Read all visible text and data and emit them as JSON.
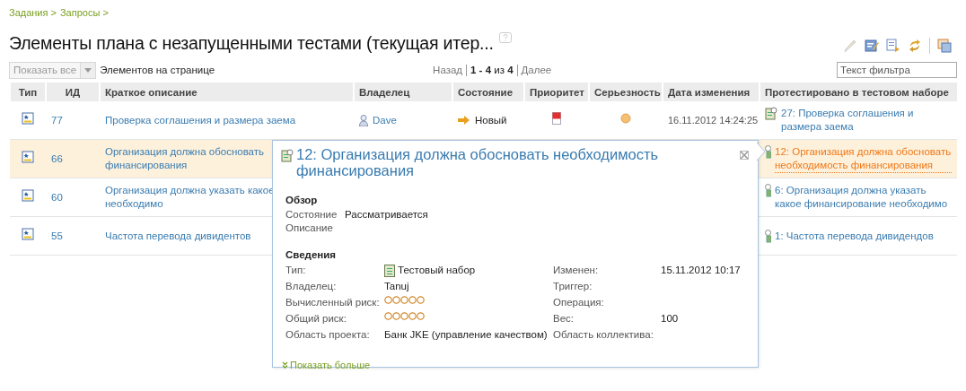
{
  "breadcrumb": [
    "Задания >",
    "Запросы >"
  ],
  "title": "Элементы плана с незапущенными тестами (текущая итер...",
  "toolbar": {
    "show_all": "Показать все",
    "per_page_label": "Элементов на странице",
    "prev": "Назад",
    "range": "**1 - 4** из **4**",
    "next": "Далее",
    "filter_placeholder": "Текст фильтра"
  },
  "table": {
    "columns": [
      "Тип",
      "ИД",
      "Краткое описание",
      "Владелец",
      "Состояние",
      "Приоритет",
      "Серьезность",
      "Дата изменения",
      "Протестировано в тестовом наборе"
    ],
    "rows": [
      {
        "id": "77",
        "summary": [
          "Проверка соглашения и размера заема"
        ],
        "owner": "Dave",
        "state": "Новый",
        "modified": "16.11.2012 14:24:25",
        "tested_in": "27: Проверка соглашения и размера заема",
        "covered": false,
        "selected": false
      },
      {
        "id": "66",
        "summary": [
          "Организация должна обосновать",
          "финансирования"
        ],
        "tested_in": "12: Организация должна обосновать необходимость финансирования",
        "covered": true,
        "selected": true
      },
      {
        "id": "60",
        "summary": [
          "Организация должна указать какое",
          "необходимо"
        ],
        "tested_in": "6: Организация должна указать какое финансирование необходимо",
        "covered": true,
        "selected": false
      },
      {
        "id": "55",
        "summary": [
          "Частота перевода дивидентов"
        ],
        "tested_in": "1: Частота перевода дивидендов",
        "covered": true,
        "selected": false
      }
    ]
  },
  "popup": {
    "title": "12: Организация должна обосновать необходимость финансирования",
    "overview": {
      "heading": "Обзор",
      "fields": [
        {
          "label": "Состояние",
          "value": "Рассматривается"
        },
        {
          "label": "Описание"
        }
      ]
    },
    "details": {
      "heading": "Сведения",
      "left": [
        {
          "kind": "type",
          "label": "Тип:",
          "value": "Тестовый набор"
        },
        {
          "kind": "text",
          "label": "Владелец:",
          "value": "Tanuj"
        },
        {
          "kind": "risk",
          "label": "Вычисленный риск:",
          "stars": 0
        },
        {
          "kind": "risk",
          "label": "Общий риск:",
          "stars": 0
        },
        {
          "kind": "text",
          "label": "Область проекта:",
          "value": "Банк JKE (управление качеством)"
        }
      ],
      "right": [
        {
          "kind": "text",
          "label": "Изменен:",
          "value": "15.11.2012 10:17"
        },
        {
          "kind": "text",
          "label": "Триггер:"
        },
        {
          "kind": "text",
          "label": "Операция:"
        },
        {
          "kind": "text",
          "label": "Вес:",
          "value": "100"
        },
        {
          "kind": "text",
          "label": "Область коллектива:"
        }
      ]
    },
    "show_more": "Показать больше"
  }
}
